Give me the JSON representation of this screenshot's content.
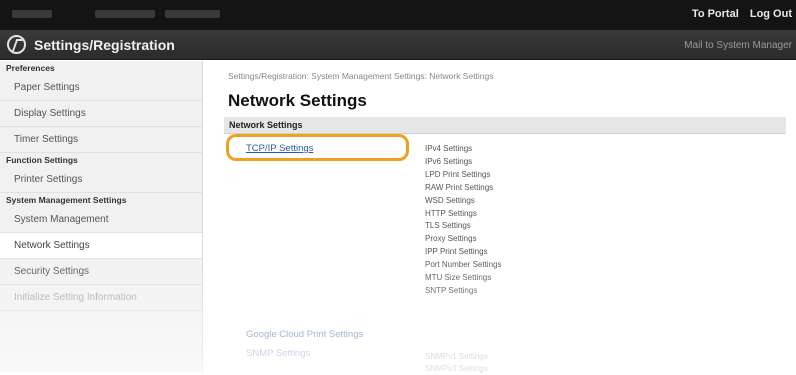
{
  "topbar": {
    "portal_link": "To Portal",
    "logout_link": "Log Out"
  },
  "header": {
    "title": "Settings/Registration",
    "mailto": "Mail to System Manager"
  },
  "sidebar": {
    "groups": [
      {
        "heading": "Preferences",
        "items": [
          "Paper Settings",
          "Display Settings",
          "Timer Settings"
        ]
      },
      {
        "heading": "Function Settings",
        "items": [
          "Printer Settings"
        ]
      },
      {
        "heading": "System Management Settings",
        "items": [
          "System Management",
          "Network Settings",
          "Security Settings",
          "Initialize Setting Information"
        ]
      }
    ]
  },
  "main": {
    "breadcrumb": "Settings/Registration: System Management Settings: Network Settings",
    "title": "Network Settings",
    "section_heading": "Network Settings",
    "tcpip_link": "TCP/IP Settings",
    "tcpip_sub": [
      "IPv4 Settings",
      "IPv6 Settings",
      "LPD Print Settings",
      "RAW Print Settings",
      "WSD Settings",
      "HTTP Settings",
      "TLS Settings",
      "Proxy Settings",
      "IPP Print Settings",
      "Port Number Settings",
      "MTU Size Settings",
      "SNTP Settings"
    ],
    "gcp_link": "Google Cloud Print Settings",
    "snmp_link": "SNMP Settings",
    "snmp_sub": [
      "SNMPv1 Settings",
      "SNMPv3 Settings"
    ]
  }
}
